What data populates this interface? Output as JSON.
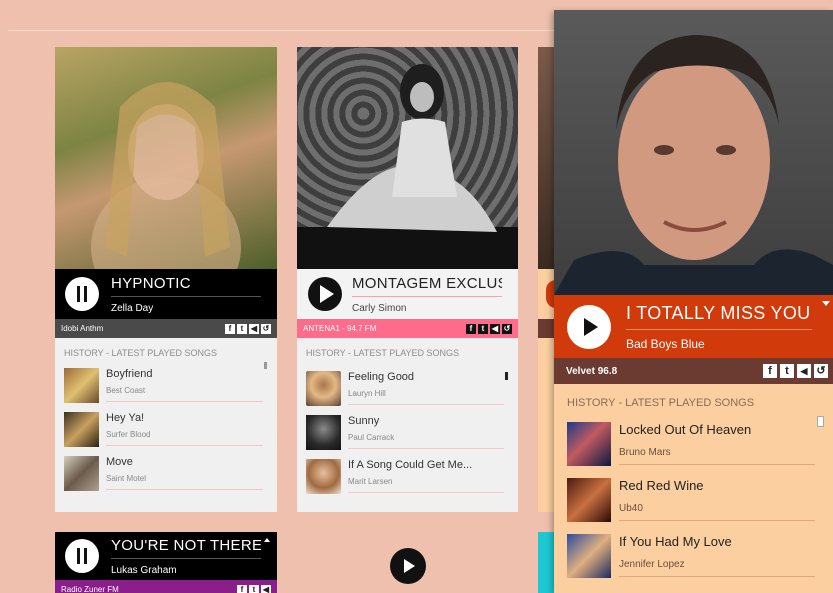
{
  "cards": {
    "c1": {
      "title": "HYPNOTIC",
      "artist": "Zella Day",
      "station": "Idobi Anthm",
      "history_label": "HISTORY - LATEST PLAYED SONGS",
      "songs": [
        {
          "title": "Boyfriend",
          "artist": "Best Coast"
        },
        {
          "title": "Hey Ya!",
          "artist": "Surfer Blood"
        },
        {
          "title": "Move",
          "artist": "Saint Motel"
        }
      ]
    },
    "c2": {
      "title": "MONTAGEM EXCLUSIVA",
      "artist": "Carly Simon",
      "station": "ANTENA1 - 94.7 FM",
      "history_label": "HISTORY - LATEST PLAYED SONGS",
      "songs": [
        {
          "title": "Feeling Good",
          "artist": "Lauryn Hill"
        },
        {
          "title": "Sunny",
          "artist": "Paul Carrack"
        },
        {
          "title": "If A Song Could Get Me...",
          "artist": "Marit Larsen"
        }
      ]
    },
    "c3": {
      "title": "I TOTALLY MISS YOU",
      "artist": "Bad Boys Blue",
      "station": "Velvet 96.8",
      "history_label": "HISTORY - LATEST PLAYED SONGS",
      "songs": [
        {
          "title": "Locked Out Of Heaven",
          "artist": "Bruno Mars"
        },
        {
          "title": "Red Red Wine",
          "artist": "Ub40"
        },
        {
          "title": "If You Had My Love",
          "artist": "Jennifer Lopez"
        }
      ]
    },
    "c4": {
      "title": "YOU'RE NOT THERE",
      "artist": "Lukas Graham",
      "station": "Radio Zuner FM"
    }
  },
  "colors": {
    "page_bg": "#eec0ad",
    "card1_bar": "#000000",
    "card2_accent": "#ff6b8a",
    "card3_accent": "#d13a0a",
    "card3_bg": "#fbcf9f",
    "card4_station": "#8a1e8a"
  },
  "icons": [
    "facebook-icon",
    "twitter-icon",
    "volume-icon",
    "history-icon",
    "play-icon",
    "pause-icon",
    "chevron-up-icon"
  ]
}
